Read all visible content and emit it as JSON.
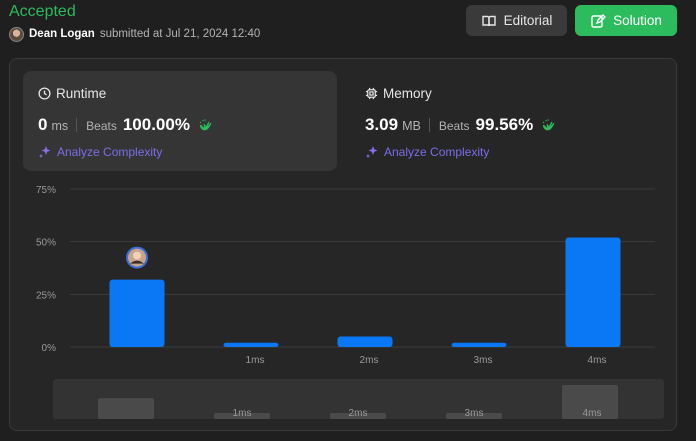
{
  "header": {
    "status": "Accepted",
    "submitter": "Dean Logan",
    "submitted_meta": "submitted at Jul 21, 2024 12:40",
    "editorial_label": "Editorial",
    "solution_label": "Solution"
  },
  "runtime": {
    "title": "Runtime",
    "value": "0",
    "unit": "ms",
    "beats_label": "Beats",
    "beats_pct": "100.00%",
    "analyze_label": "Analyze Complexity"
  },
  "memory": {
    "title": "Memory",
    "value": "3.09",
    "unit": "MB",
    "beats_label": "Beats",
    "beats_pct": "99.56%",
    "analyze_label": "Analyze Complexity"
  },
  "colors": {
    "accent_green": "#2cbb5d",
    "bar_blue": "#0a78f5",
    "analyze_purple": "#7b6ee8"
  },
  "chart_data": {
    "type": "bar",
    "categories": [
      "",
      "1ms",
      "2ms",
      "3ms",
      "4ms"
    ],
    "values": [
      32,
      2,
      5,
      2,
      52
    ],
    "ylim": [
      0,
      75
    ],
    "yticks": [
      "0%",
      "25%",
      "50%",
      "75%"
    ],
    "grid": true,
    "highlight_index": 0
  },
  "mini_chart": {
    "categories": [
      "",
      "1ms",
      "2ms",
      "3ms",
      "4ms"
    ],
    "values": [
      32,
      2,
      5,
      2,
      52
    ]
  }
}
